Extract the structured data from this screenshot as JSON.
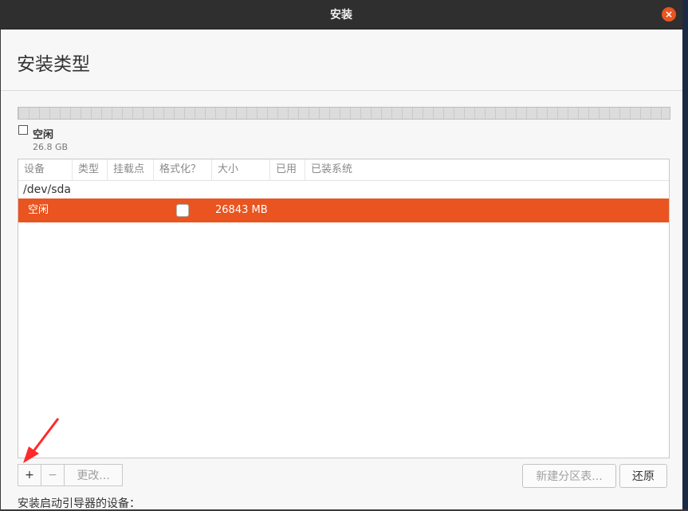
{
  "window": {
    "title": "安装",
    "close_icon": "×"
  },
  "page": {
    "title": "安装类型"
  },
  "legend": {
    "label": "空闲",
    "size": "26.8 GB"
  },
  "table": {
    "columns": [
      "设备",
      "类型",
      "挂载点",
      "格式化？",
      "大小",
      "已用",
      "已装系统"
    ],
    "device": "/dev/sda",
    "rows": [
      {
        "device": "空闲",
        "type": "",
        "mount": "",
        "format": false,
        "size": "26843 MB",
        "used": "",
        "system": ""
      }
    ]
  },
  "toolbar": {
    "add": "+",
    "remove": "−",
    "change": "更改..."
  },
  "actions": {
    "new_table": "新建分区表...",
    "revert": "还原"
  },
  "bootloader": {
    "label": "安装启动引导器的设备："
  },
  "colors": {
    "accent": "#e95420",
    "annotation": "#ff2a2a"
  }
}
